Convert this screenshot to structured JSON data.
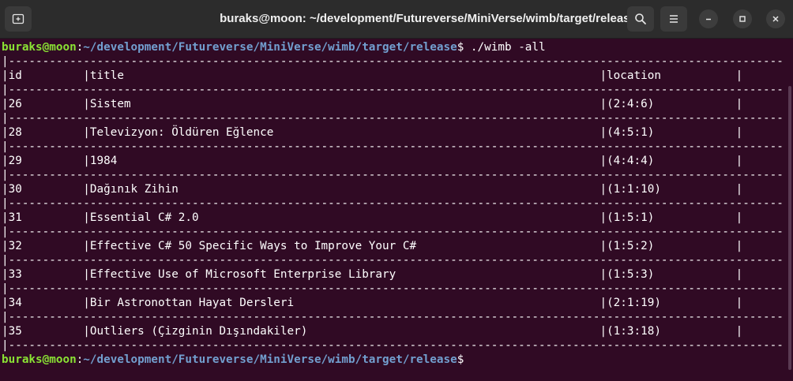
{
  "window": {
    "title": "buraks@moon: ~/development/Futureverse/MiniVerse/wimb/target/release"
  },
  "icons": {
    "new_tab": "new-tab-icon",
    "search": "search-icon",
    "menu": "hamburger-menu-icon",
    "minimize": "minimize-icon",
    "maximize": "maximize-icon",
    "close": "close-icon"
  },
  "colors": {
    "background": "#300a24",
    "prompt_user": "#8ae234",
    "prompt_path": "#729fcf",
    "text": "#ffffff"
  },
  "terminal": {
    "prompt1": {
      "user": "buraks@moon",
      "colon": ":",
      "path": "~/development/Futureverse/MiniVerse/wimb/target/release",
      "symbol": "$",
      "command": " ./wimb -all"
    },
    "separator": "|-------------------------------------------------------------------------------------------------------------------------------|",
    "header": {
      "id": "id",
      "title": "title",
      "location": "location"
    },
    "rows": [
      {
        "id": "26",
        "title": "Sistem",
        "location": "(2:4:6)"
      },
      {
        "id": "28",
        "title": "Televizyon: Öldüren Eğlence",
        "location": "(4:5:1)"
      },
      {
        "id": "29",
        "title": "1984",
        "location": "(4:4:4)"
      },
      {
        "id": "30",
        "title": "Dağınık Zihin",
        "location": "(1:1:10)"
      },
      {
        "id": "31",
        "title": "Essential C# 2.0",
        "location": "(1:5:1)"
      },
      {
        "id": "32",
        "title": "Effective C# 50 Specific Ways to Improve Your C#",
        "location": "(1:5:2)"
      },
      {
        "id": "33",
        "title": "Effective Use of Microsoft Enterprise Library",
        "location": "(1:5:3)"
      },
      {
        "id": "34",
        "title": "Bir Astronottan Hayat Dersleri",
        "location": "(2:1:19)"
      },
      {
        "id": "35",
        "title": "Outliers (Çizginin Dışındakiler)",
        "location": "(1:3:18)"
      }
    ],
    "prompt2": {
      "user": "buraks@moon",
      "colon": ":",
      "path": "~/development/Futureverse/MiniVerse/wimb/target/release",
      "symbol": "$"
    }
  }
}
